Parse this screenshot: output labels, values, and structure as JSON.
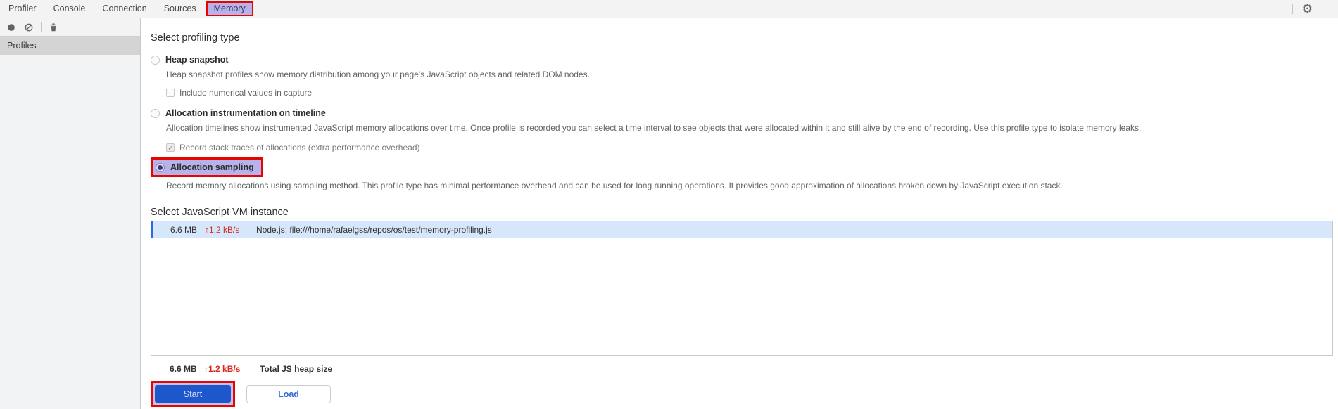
{
  "tabbar": {
    "tabs": [
      {
        "label": "Profiler",
        "selected": false
      },
      {
        "label": "Console",
        "selected": false
      },
      {
        "label": "Connection",
        "selected": false
      },
      {
        "label": "Sources",
        "selected": false
      },
      {
        "label": "Memory",
        "selected": true
      }
    ],
    "icons": {
      "settings": "gear-icon",
      "settings_glyph": "⚙"
    }
  },
  "toolbar": {
    "icons": [
      {
        "name": "record-icon"
      },
      {
        "name": "clear-icon"
      },
      {
        "name": "delete-icon"
      }
    ]
  },
  "sidebar": {
    "profiles_label": "Profiles"
  },
  "profiling": {
    "heading": "Select profiling type",
    "options": [
      {
        "label": "Heap snapshot",
        "checked": false,
        "desc": "Heap snapshot profiles show memory distribution among your page's JavaScript objects and related DOM nodes.",
        "sub_checkbox": {
          "label": "Include numerical values in capture",
          "checked": false
        }
      },
      {
        "label": "Allocation instrumentation on timeline",
        "checked": false,
        "desc": "Allocation timelines show instrumented JavaScript memory allocations over time. Once profile is recorded you can select a time interval to see objects that were allocated within it and still alive by the end of recording. Use this profile type to isolate memory leaks.",
        "sub_checkbox": {
          "label": "Record stack traces of allocations (extra performance overhead)",
          "checked": true,
          "disabled": true
        }
      },
      {
        "label": "Allocation sampling",
        "checked": true,
        "annotated": true,
        "desc": "Record memory allocations using sampling method. This profile type has minimal performance overhead and can be used for long running operations. It provides good approximation of allocations broken down by JavaScript execution stack."
      }
    ]
  },
  "vm": {
    "heading": "Select JavaScript VM instance",
    "row": {
      "size": "6.6 MB",
      "rate": "↑1.2 kB/s",
      "name": "Node.js: file:///home/rafaelgss/repos/os/test/memory-profiling.js",
      "selected": true
    },
    "total": {
      "size": "6.6 MB",
      "rate": "↑1.2 kB/s",
      "label": "Total JS heap size"
    }
  },
  "actions": {
    "start": "Start",
    "load": "Load"
  },
  "colors": {
    "annotation_red": "#e60400",
    "annotation_lavender": "#b7b3ea",
    "accent_blue": "#1e56cb",
    "selected_row_bg": "#d7e7fb",
    "selected_row_bar": "#2b6be0",
    "rate_red": "#d7291f",
    "link_blue": "#2f6bdb"
  }
}
